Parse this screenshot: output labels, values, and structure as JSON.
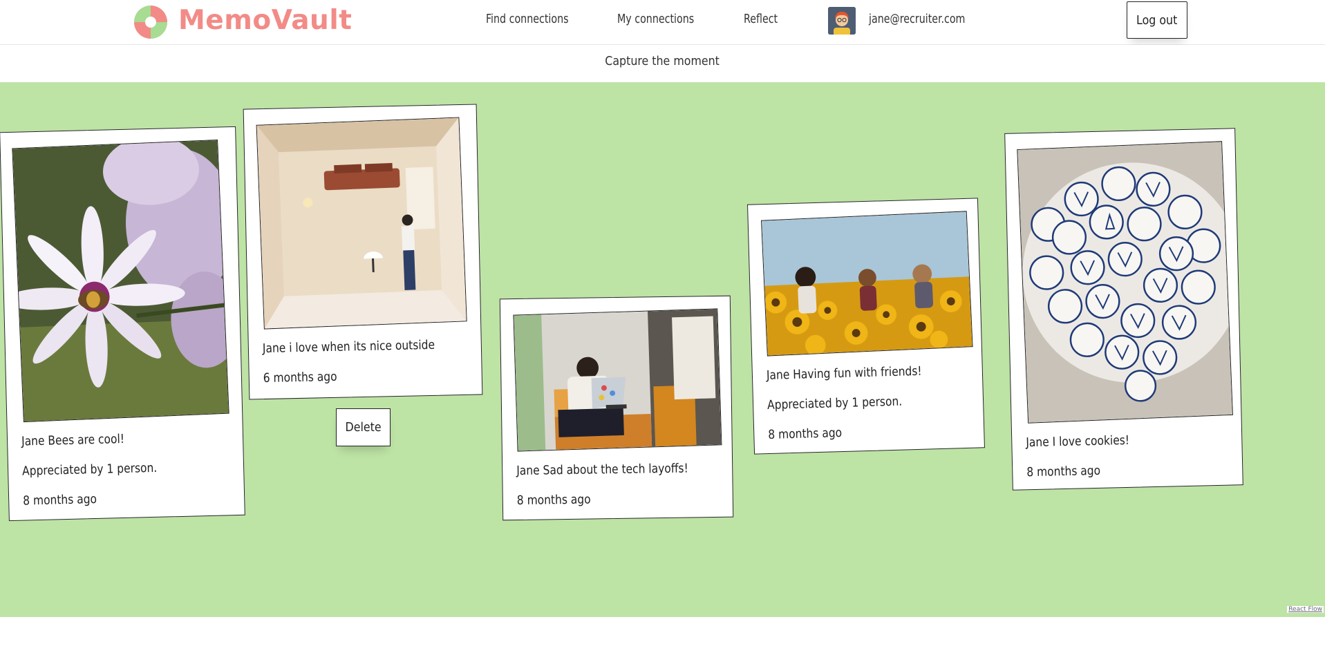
{
  "header": {
    "brand": "MemoVault",
    "nav": {
      "find": "Find connections",
      "my": "My connections",
      "reflect": "Reflect"
    },
    "user_email": "jane@recruiter.com",
    "logout_label": "Log out"
  },
  "subbar": {
    "capture_label": "Capture the moment"
  },
  "cards": [
    {
      "caption": "Jane Bees are cool!",
      "appreciation": "Appreciated by 1 person.",
      "time": "8 months ago",
      "image": "daisy-with-bee"
    },
    {
      "caption": "Jane i love when its nice outside",
      "time": "6 months ago",
      "image": "person-in-room"
    },
    {
      "caption": "Jane Sad about the tech layoffs!",
      "time": "8 months ago",
      "image": "person-at-laptop"
    },
    {
      "caption": "Jane Having fun with friends!",
      "appreciation": "Appreciated by 1 person.",
      "time": "8 months ago",
      "image": "friends-in-sunflowers"
    },
    {
      "caption": "Jane I love cookies!",
      "time": "8 months ago",
      "image": "plate-of-cookies"
    }
  ],
  "delete_label": "Delete",
  "footer": {
    "attribution": "React Flow"
  },
  "colors": {
    "brand": "#f28b87",
    "board": "#bde3a5",
    "logo_green": "#9fd88a"
  }
}
